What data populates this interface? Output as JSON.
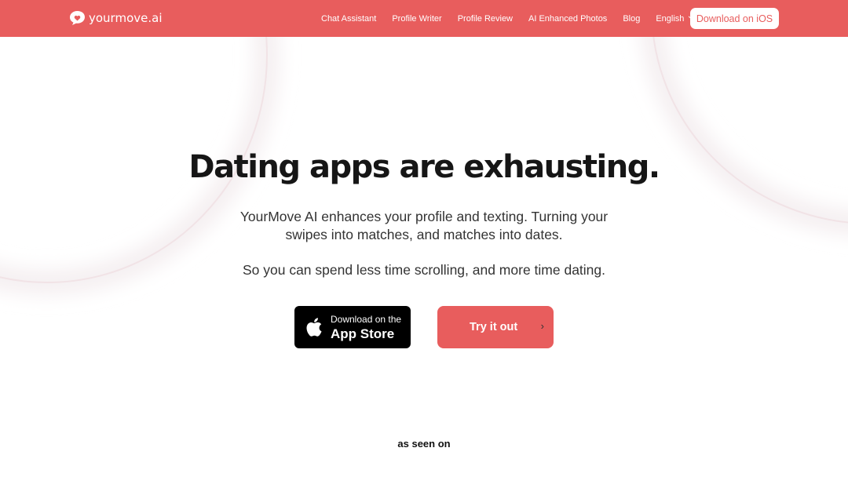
{
  "brand": {
    "name": "yourmove.ai",
    "color": "#e85d5d"
  },
  "nav": {
    "items": [
      "Chat Assistant",
      "Profile Writer",
      "Profile Review",
      "AI Enhanced Photos",
      "Blog"
    ],
    "language": "English",
    "cta": "Download on iOS"
  },
  "hero": {
    "title": "Dating apps are exhausting.",
    "subtitle_line1": "YourMove AI enhances your profile and texting. Turning your",
    "subtitle_line2": "swipes into matches, and matches into dates.",
    "tagline": "So you can spend less time scrolling, and more time dating."
  },
  "buttons": {
    "appstore_small": "Download on the",
    "appstore_big": "App Store",
    "try": "Try it out"
  },
  "seen_on": "as seen on"
}
